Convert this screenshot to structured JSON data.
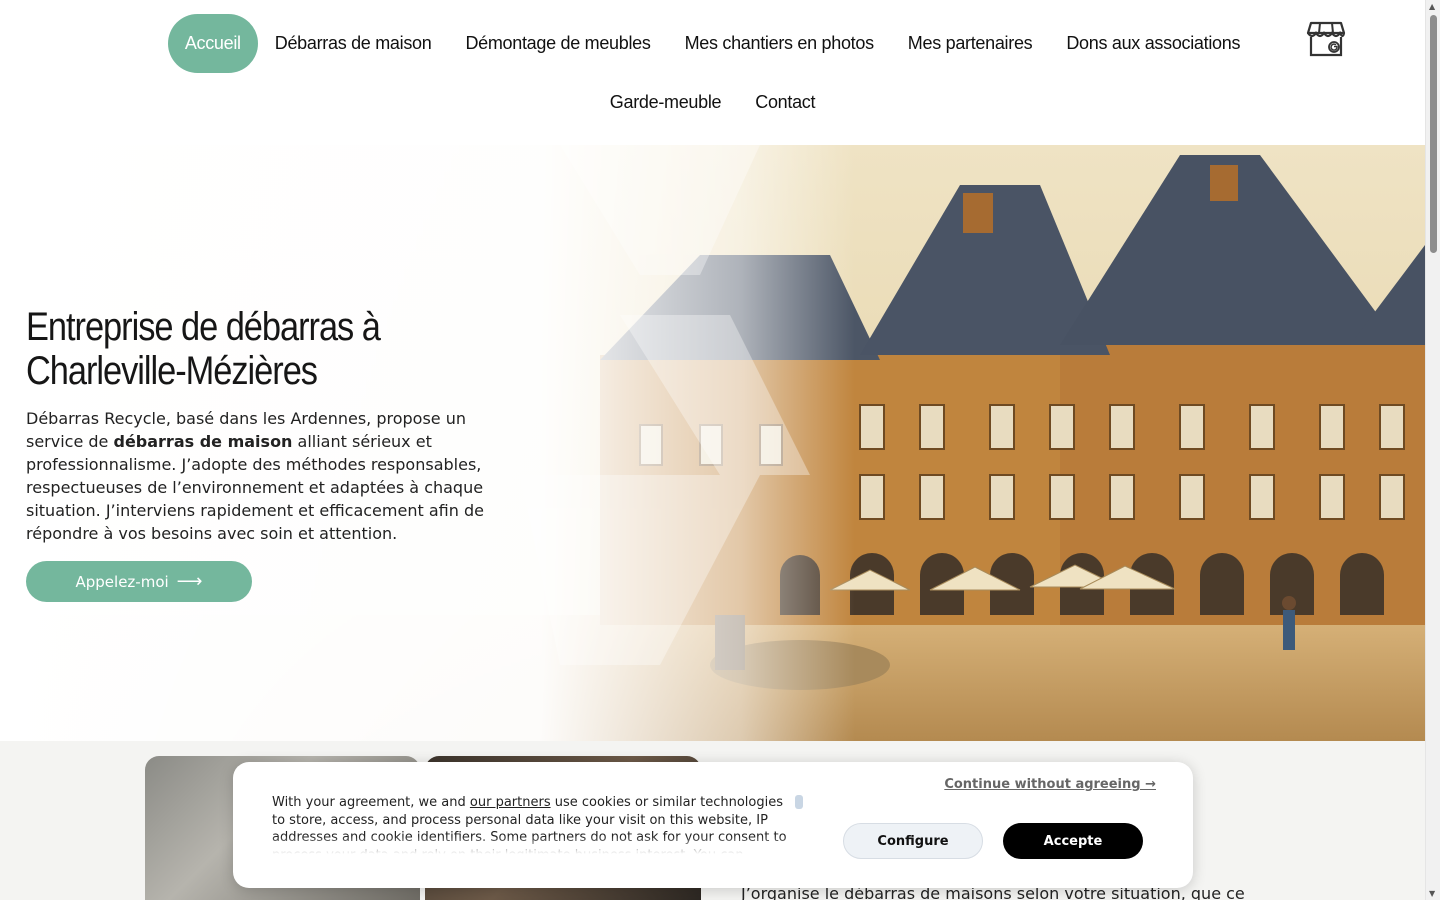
{
  "nav": {
    "row1": [
      {
        "label": "Accueil",
        "active": true
      },
      {
        "label": "Débarras de maison"
      },
      {
        "label": "Démontage de meubles"
      },
      {
        "label": "Mes chantiers en photos"
      },
      {
        "label": "Mes partenaires"
      },
      {
        "label": "Dons aux associations"
      }
    ],
    "row2": [
      {
        "label": "Garde-meuble"
      },
      {
        "label": "Contact"
      }
    ],
    "shop_icon": "google-business-store-icon"
  },
  "hero": {
    "title": "Entreprise de débarras à Charleville-Mézières",
    "body_part1": "Débarras Recycle, basé dans les Ardennes, propose un service de ",
    "body_bold": "débarras de maison",
    "body_part2": " alliant sérieux et professionnalisme. J’adopte des méthodes responsables, respectueuses de l’environnement et adaptées à chaque situation. J’interviens rapidement et efficacement afin de répondre à vos besoins avec soin et attention.",
    "cta_label": "Appelez-moi",
    "cta_icon": "arrow-right-icon"
  },
  "section": {
    "text": "J’organise le débarras de maisons selon votre situation, que ce"
  },
  "cookie": {
    "text_before_link": "With your agreement, we and ",
    "link_label": "our partners",
    "text_after_link": " use cookies or similar technologies to store, access, and process personal data like your visit on this website, IP addresses and cookie identifiers. Some partners do not ask for your consent to process your data and rely on their legitimate business interest. You can",
    "continue_label": "Continue without agreeing →",
    "configure_label": "Configure",
    "accept_label": "Accepte"
  },
  "colors": {
    "accent": "#74b79d",
    "accept_bg": "#000000"
  }
}
